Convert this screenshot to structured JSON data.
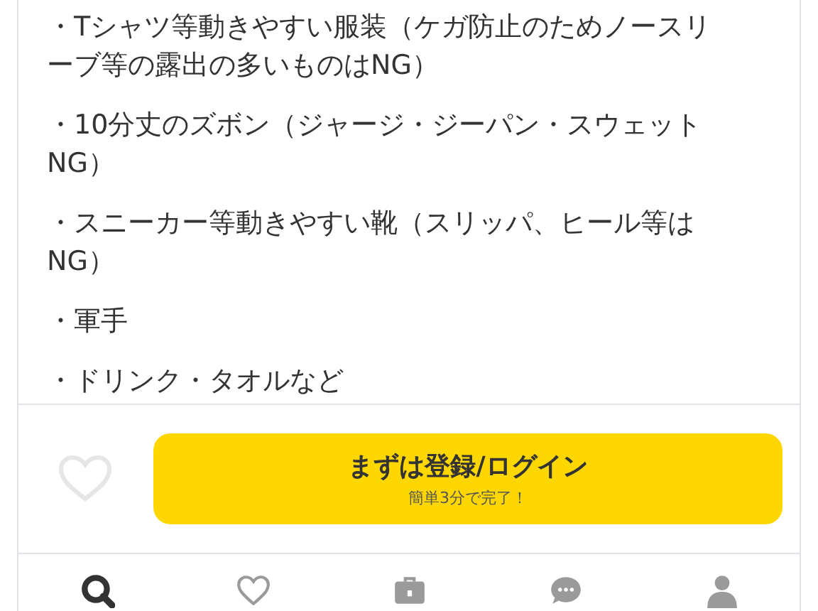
{
  "items": [
    "・Tシャツ等動きやすい服装（ケガ防止のためノースリーブ等の露出の多いものはNG）",
    "・10分丈のズボン（ジャージ・ジーパン・スウェットNG）",
    "・スニーカー等動きやすい靴（スリッパ、ヒール等はNG）",
    "・軍手",
    "・ドリンク・タオルなど"
  ],
  "cta": {
    "label": "まずは登録/ログイン",
    "sub": "簡単3分で完了！"
  },
  "nav": [
    {
      "kind": "search",
      "selected": true
    },
    {
      "kind": "heart",
      "selected": false
    },
    {
      "kind": "briefcase",
      "selected": false
    },
    {
      "kind": "chat",
      "selected": false
    },
    {
      "kind": "person",
      "selected": false
    }
  ]
}
